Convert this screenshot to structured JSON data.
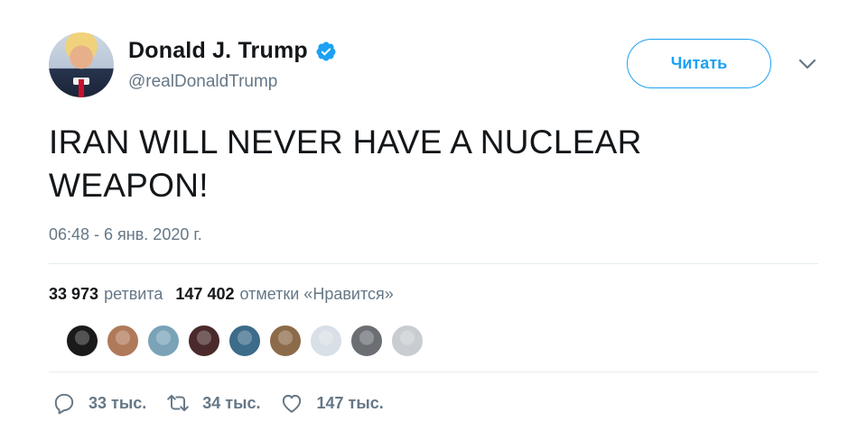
{
  "author": {
    "name": "Donald J. Trump",
    "handle": "@realDonaldTrump",
    "verified": true,
    "avatar_icon": "profile-photo"
  },
  "follow_button": {
    "label": "Читать"
  },
  "menu_icon": "chevron-down-icon",
  "tweet": {
    "text": "IRAN WILL NEVER HAVE A NUCLEAR WEAPON!",
    "timestamp": "06:48 - 6 янв. 2020 г."
  },
  "stats": {
    "retweets_count": "33 973",
    "retweets_label": "ретвита",
    "likes_count": "147 402",
    "likes_label": "отметки «Нравится»"
  },
  "likers": [
    {
      "name": "liker-1",
      "color": "#1a1a1a"
    },
    {
      "name": "liker-2",
      "color": "#b07a5a"
    },
    {
      "name": "liker-3",
      "color": "#7aa3b8"
    },
    {
      "name": "liker-4",
      "color": "#4a2a2a"
    },
    {
      "name": "liker-5",
      "color": "#3d6b8a"
    },
    {
      "name": "liker-6",
      "color": "#8c6b4a"
    },
    {
      "name": "liker-7",
      "color": "#d8dfe6"
    },
    {
      "name": "liker-8",
      "color": "#6b6f74"
    },
    {
      "name": "liker-9",
      "color": "#c9ccd0"
    }
  ],
  "actions": {
    "reply_count": "33 тыс.",
    "retweet_count": "34 тыс.",
    "like_count": "147 тыс."
  },
  "colors": {
    "accent": "#1da1f2",
    "text_primary": "#14171a",
    "text_secondary": "#657786",
    "divider": "#e6ecf0"
  }
}
